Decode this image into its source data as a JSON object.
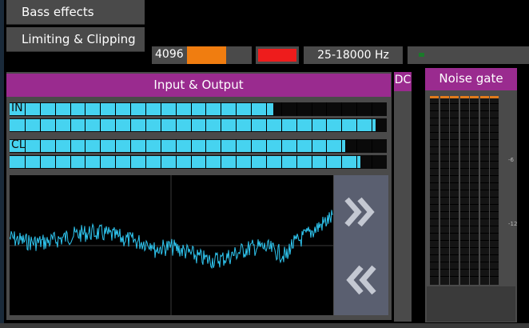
{
  "menu": {
    "bass_effects": "Bass effects",
    "limiting_clipping": "Limiting & Clipping"
  },
  "status": {
    "fft_size": "4096",
    "fft_fill_fraction": 0.6,
    "freq_range": "25-18000 Hz"
  },
  "io_panel": {
    "title": "Input & Output",
    "meters": [
      {
        "label": "IN",
        "level": 0.7
      },
      {
        "label": "",
        "level": 0.97
      },
      {
        "label": "CL",
        "level": 0.89
      },
      {
        "label": "",
        "level": 0.93
      }
    ]
  },
  "dc": {
    "label": "DC"
  },
  "noise_gate": {
    "title": "Noise gate",
    "scale_labels": [
      "-6",
      "-12"
    ]
  },
  "colors": {
    "accent": "#9a2b8f",
    "meter": "#46d3f0",
    "orange": "#f07d10",
    "red": "#ee1c1c",
    "panel": "#4a4a4a"
  },
  "icons": {
    "forward": "double-chevron-right-icon",
    "back": "double-chevron-left-icon"
  }
}
